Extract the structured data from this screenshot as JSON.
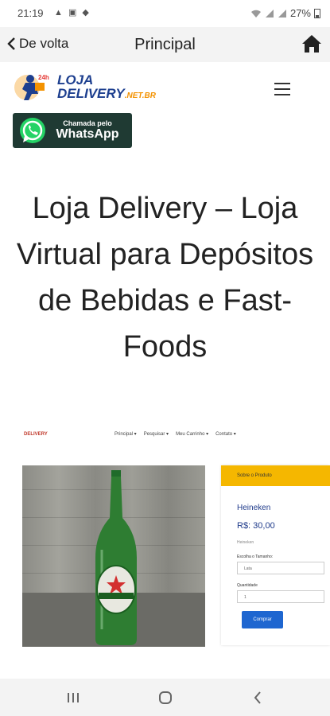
{
  "status_bar": {
    "time": "21:19",
    "battery": "27%",
    "icons": [
      "notification-icon",
      "image-icon",
      "app-icon",
      "wifi-icon",
      "signal-icon",
      "signal-icon",
      "battery-icon"
    ]
  },
  "top_bar": {
    "back_label": "De volta",
    "title": "Principal",
    "home_icon": "home-icon"
  },
  "logo": {
    "badge": "24h",
    "line1": "LOJA",
    "line2": "DELIVERY",
    "tld": ".NET.BR"
  },
  "whatsapp": {
    "small": "Chamada pelo",
    "big": "WhatsApp"
  },
  "headline": "Loja Delivery – Loja Virtual para Depósitos de Bebidas e Fast-Foods",
  "preview": {
    "logo": "DELIVERY",
    "menu": [
      "Principal ▾",
      "Pesquisar ▾",
      "Meu Carrinho ▾",
      "Contato ▾"
    ],
    "card_header": "Sobre o Produto",
    "product_name": "Heineken",
    "price": "R$: 30,00",
    "subtitle": "Heineken",
    "size_label": "Escolha o Tamanho:",
    "size_value": "Lata",
    "qty_label": "Quantidade",
    "qty_value": "1",
    "buy_label": "Comprar"
  },
  "colors": {
    "accent_yellow": "#f5b700",
    "button_blue": "#1e66d0",
    "brand_blue": "#1d3f8f",
    "whatsapp_green": "#25d366"
  }
}
